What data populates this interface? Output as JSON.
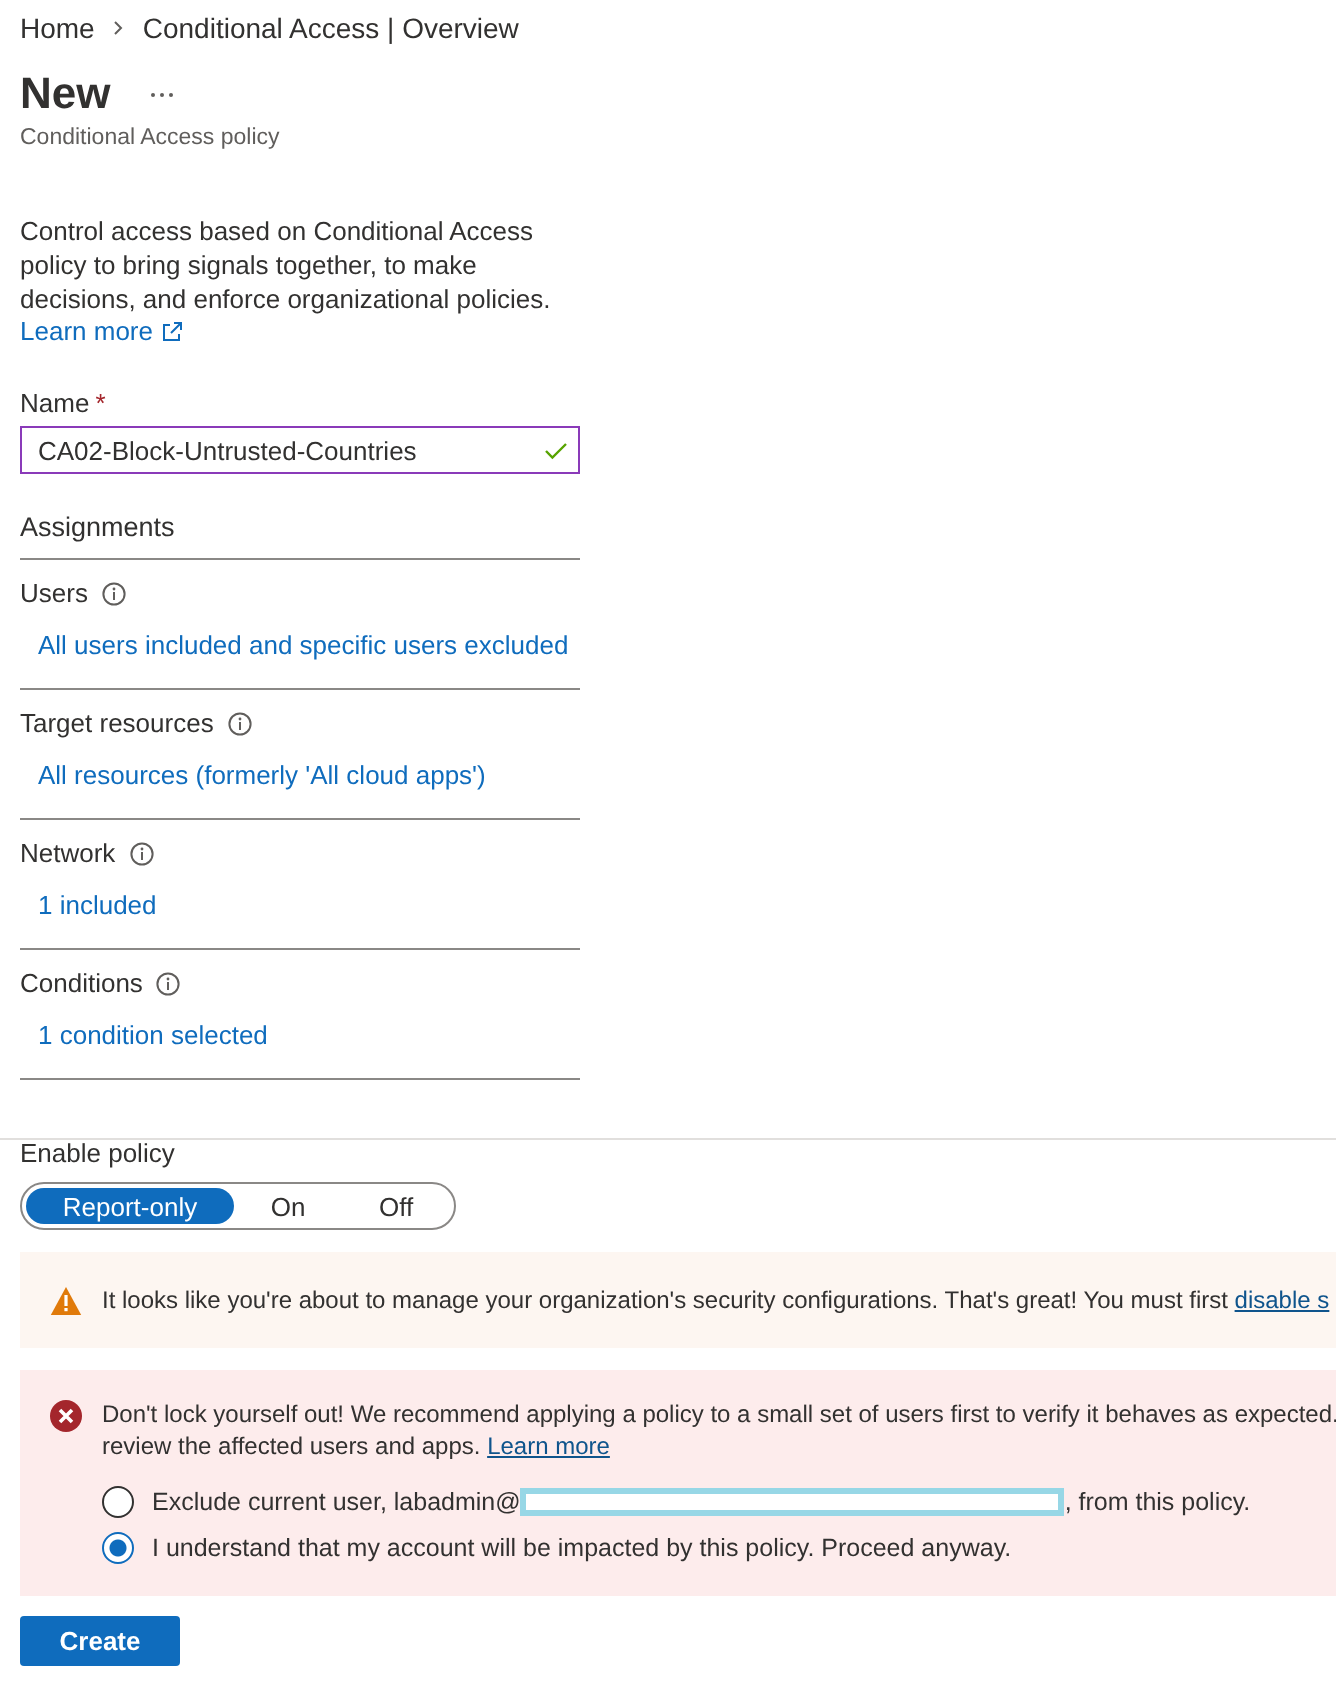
{
  "breadcrumb": [
    {
      "label": "Home"
    },
    {
      "label": "Conditional Access | Overview"
    }
  ],
  "title": "New",
  "subtitle": "Conditional Access policy",
  "description": "Control access based on Conditional Access policy to bring signals together, to make decisions, and enforce organizational policies.",
  "learn_more": "Learn more",
  "name_field": {
    "label": "Name",
    "required_mark": "*",
    "value": "CA02-Block-Untrusted-Countries",
    "valid": true
  },
  "assignments": {
    "title": "Assignments",
    "sections": [
      {
        "label": "Users",
        "value": "All users included and specific users excluded"
      },
      {
        "label": "Target resources",
        "value": "All resources (formerly 'All cloud apps')"
      },
      {
        "label": "Network",
        "value": "1 included"
      },
      {
        "label": "Conditions",
        "value": "1 condition selected"
      }
    ]
  },
  "enable_policy": {
    "label": "Enable policy",
    "options": [
      {
        "label": "Report-only",
        "selected": true
      },
      {
        "label": "On",
        "selected": false
      },
      {
        "label": "Off",
        "selected": false
      }
    ]
  },
  "banners": [
    {
      "kind": "warning",
      "lines": [
        {
          "text": "It looks like you're about to manage your organization's security configurations. That's great! You must first ",
          "link": "disable s"
        }
      ]
    },
    {
      "kind": "error",
      "lines": [
        {
          "text": "Don't lock yourself out! We recommend applying a policy to a small set of users first to verify it behaves as expected."
        },
        {
          "text": "review the affected users and apps. ",
          "link": "Learn more"
        }
      ],
      "options": [
        {
          "text": "Exclude current user, labadmin@",
          "redacted": true,
          "suffix": ", from this policy.",
          "selected": false
        },
        {
          "text": "I understand that my account will be impacted by this policy. Proceed anyway.",
          "redacted": false,
          "selected": true
        }
      ]
    }
  ],
  "create_button": "Create"
}
